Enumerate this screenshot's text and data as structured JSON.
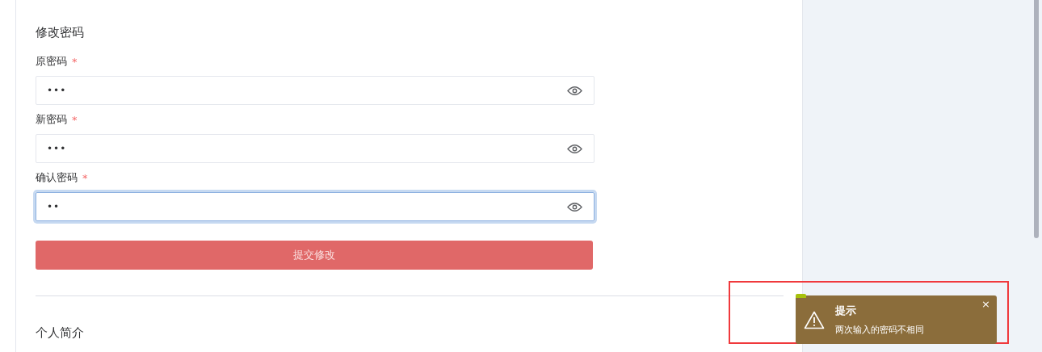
{
  "section_title": "修改密码",
  "fields": [
    {
      "label": "原密码",
      "required_mark": "*",
      "value": "•••",
      "focused": false
    },
    {
      "label": "新密码",
      "required_mark": "*",
      "value": "•••",
      "focused": false
    },
    {
      "label": "确认密码",
      "required_mark": "*",
      "value": "••",
      "focused": true
    }
  ],
  "submit_button": "提交修改",
  "next_section_title": "个人简介",
  "toast": {
    "title": "提示",
    "message": "两次输入的密码不相同",
    "close": "×"
  }
}
